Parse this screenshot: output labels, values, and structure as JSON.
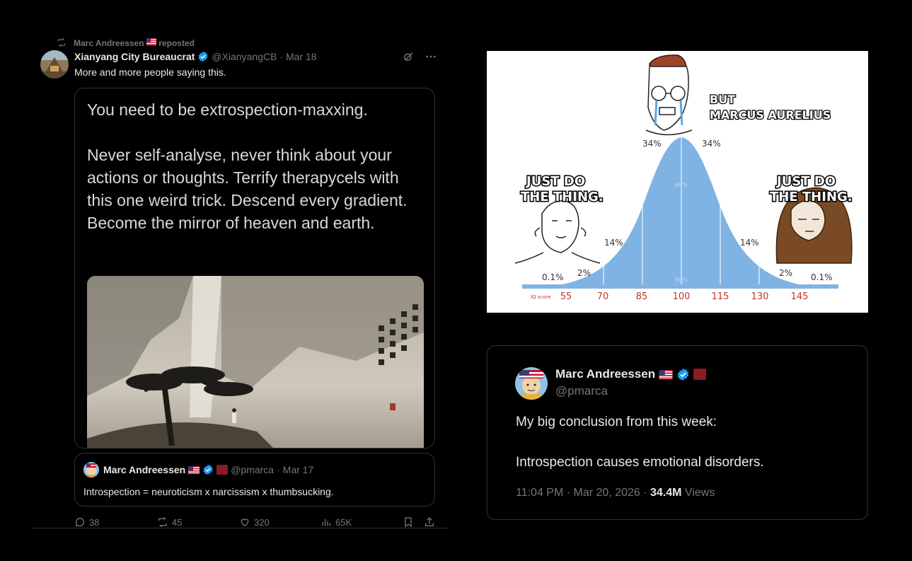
{
  "left_tweet": {
    "repost_label": "Marc Andreessen",
    "repost_suffix": "reposted",
    "author_name": "Xianyang City Bureaucrat",
    "author_handle": "@XianyangCB",
    "date": "· Mar 18",
    "text": "More and more people saying this.",
    "card_text": "You need to be extrospection-maxxing.\n\nNever self-analyse, never think about your actions or thoughts. Terrify therapycels with this one weird trick. Descend every gradient. Become the mirror of heaven and earth.",
    "quote": {
      "author_name": "Marc Andreessen",
      "author_handle": "@pmarca",
      "date": "· Mar 17",
      "text": "Introspection = neuroticism x narcissism x thumbsucking."
    },
    "actions": {
      "replies": "38",
      "reposts": "45",
      "likes": "320",
      "views": "65K"
    }
  },
  "meme": {
    "label_center": "BUT\nMARCUS AURELIUS",
    "label_left": "JUST DO\nTHE THING.",
    "label_right": "JUST DO\nTHE THING.",
    "pct_34": "34%",
    "pct_68": "68%",
    "pct_14": "14%",
    "pct_2": "2%",
    "pct_01": "0.1%",
    "pct_95": "95%",
    "iq_label": "IQ score",
    "ticks": [
      "55",
      "70",
      "85",
      "100",
      "115",
      "130",
      "145"
    ]
  },
  "right_tweet": {
    "author_name": "Marc Andreessen",
    "author_handle": "@pmarca",
    "text_line1": "My big conclusion from this week:",
    "text_line2": "Introspection causes emotional disorders.",
    "timestamp": "11:04 PM · Mar 20, 2026 · ",
    "views_count": "34.4M",
    "views_label": " Views"
  },
  "colors": {
    "background": "#000000",
    "verified_blue": "#1d9bf0",
    "muted": "#71767b",
    "curve_blue": "#7fb3e3",
    "tick_red": "#c0392b"
  }
}
